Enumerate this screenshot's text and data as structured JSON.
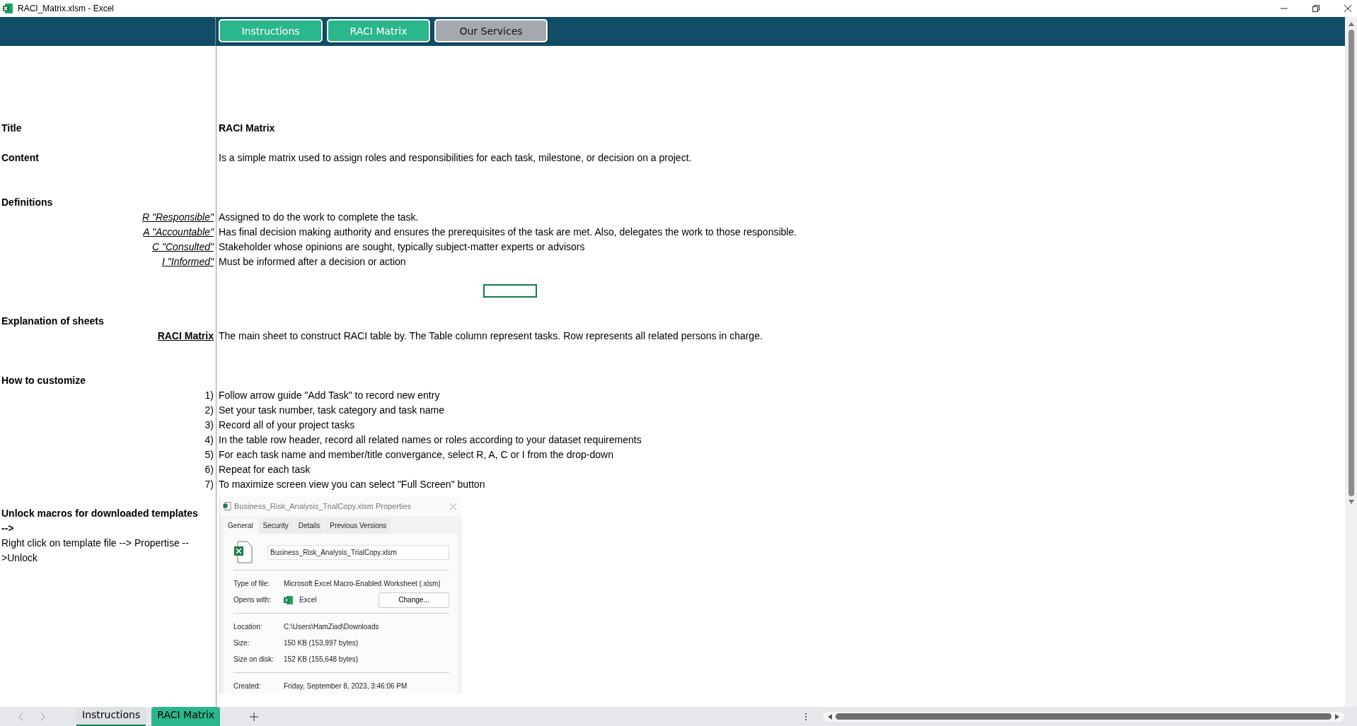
{
  "window": {
    "title": "RACI_Matrix.xlsm - Excel"
  },
  "nav_buttons": [
    {
      "label": "Instructions",
      "color": "#2bb68b"
    },
    {
      "label": "RACI Matrix",
      "color": "#2bb68b"
    },
    {
      "label": "Our Services",
      "color": "#a4a9ae"
    }
  ],
  "title_row": {
    "label": "Title",
    "value": "RACI Matrix"
  },
  "content_row": {
    "label": "Content",
    "value": "Is a simple matrix used to assign roles and responsibilities for each task, milestone, or decision on a project."
  },
  "definitions": {
    "heading": "Definitions",
    "items": [
      {
        "term": "R \"Responsible\"",
        "text": "Assigned to do the work to complete the task."
      },
      {
        "term": "A \"Accountable\"",
        "text": "Has final decision making authority and ensures the prerequisites of the task are met. Also, delegates the work to those responsible."
      },
      {
        "term": "C \"Consulted\"",
        "text": "Stakeholder whose opinions are sought, typically subject-matter experts or advisors"
      },
      {
        "term": "I \"Informed\"",
        "text": "Must be informed after a decision or action"
      }
    ]
  },
  "explanation": {
    "heading": "Explanation of sheets",
    "items": [
      {
        "term": "RACI Matrix",
        "text": "The main sheet to construct RACI table by. The Table column represent tasks. Row represents all related persons in charge."
      }
    ]
  },
  "customize": {
    "heading": "How to customize",
    "steps": [
      {
        "number": "1)",
        "text": "Follow arrow guide \"Add Task\" to record new entry"
      },
      {
        "number": "2)",
        "text": "Set your task number, task category and task name"
      },
      {
        "number": "3)",
        "text": "Record all of your project tasks"
      },
      {
        "number": "4)",
        "text": "In the table row header, record all related names or roles according to your dataset requirements"
      },
      {
        "number": "5)",
        "text": "For each task name and member/title convergance, select R, A, C or I from the drop-down"
      },
      {
        "number": "6)",
        "text": "Repeat for each task"
      },
      {
        "number": "7)",
        "text": "To maximize screen view you can select \"Full Screen\" button"
      }
    ]
  },
  "unlock": {
    "heading": "Unlock macros for downloaded templates -->",
    "text": "Right click on template file --> Propertise -->Unlock"
  },
  "properties_dialog": {
    "title": "Business_Risk_Analysis_TrialCopy.xlsm Properties",
    "tabs": [
      {
        "label": "General",
        "selected": true
      },
      {
        "label": "Security",
        "selected": false
      },
      {
        "label": "Details",
        "selected": false
      },
      {
        "label": "Previous Versions",
        "selected": false
      }
    ],
    "file_name": "Business_Risk_Analysis_TrialCopy.xlsm",
    "type_label": "Type of file:",
    "type_value": "Microsoft Excel Macro-Enabled Worksheet (.xlsm)",
    "opens_label": "Opens with:",
    "opens_value": "Excel",
    "change_button": "Change...",
    "info": [
      {
        "label": "Location:",
        "value": "C:\\Users\\HamZiad\\Downloads"
      },
      {
        "label": "Size:",
        "value": "150 KB (153,997 bytes)"
      },
      {
        "label": "Size on disk:",
        "value": "152 KB (155,648 bytes)"
      }
    ],
    "created_label": "Created:",
    "created_value": "Friday, September 8, 2023, 3:46:06 PM"
  },
  "sheet_tabs": [
    {
      "label": "Instructions",
      "selected": true,
      "color": "#e4e6ea"
    },
    {
      "label": "RACI Matrix",
      "selected": false,
      "color": "#2bb68b"
    }
  ]
}
